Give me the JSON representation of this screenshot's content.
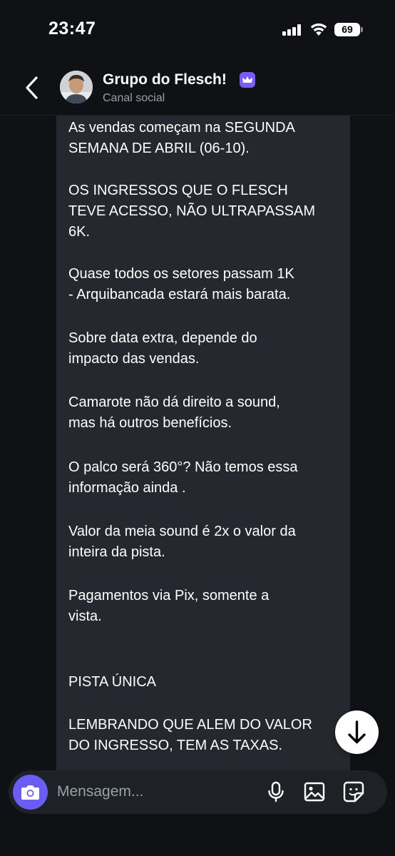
{
  "status_bar": {
    "time": "23:47",
    "battery": "69"
  },
  "header": {
    "title": "Grupo do Flesch!",
    "subtitle": "Canal social",
    "badge_icon": "crown-icon",
    "accent_color": "#7c5cff"
  },
  "message": {
    "paragraphs": [
      "As vendas começam na SEGUNDA\nSEMANA DE ABRIL (06-10).",
      "OS INGRESSOS QUE O FLESCH\nTEVE ACESSO, NÃO ULTRAPASSAM\n6K.",
      "Quase todos os setores passam 1K\n- Arquibancada estará mais barata.",
      "Sobre data extra, depende do\nimpacto das vendas.",
      "Camarote não dá direito a sound,\nmas há outros benefícios.",
      "O palco será 360°? Não temos essa\ninformação ainda .",
      "Valor da meia sound é 2x o valor da\ninteira da pista.",
      "Pagamentos via Pix, somente a\nvista.",
      "PISTA ÚNICA",
      "LEMBRANDO QUE ALEM DO VALOR\nDO INGRESSO, TEM AS TAXAS."
    ]
  },
  "composer": {
    "placeholder": "Mensagem...",
    "icons": [
      "camera-icon",
      "microphone-icon",
      "image-icon",
      "sticker-icon"
    ]
  }
}
